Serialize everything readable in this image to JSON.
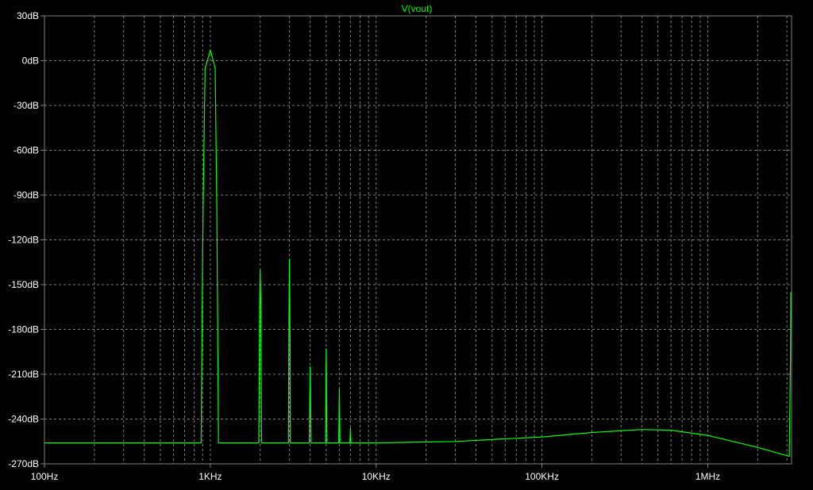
{
  "colors": {
    "background": "#000000",
    "frame": "#808080",
    "grid": "#808080",
    "trace": "#00ff00",
    "axis_text": "#ffffff",
    "title_text": "#00ff00"
  },
  "chart_data": {
    "type": "line",
    "title": "V(vout)",
    "xlabel": "",
    "ylabel": "",
    "x_scale": "log",
    "xlim": [
      100,
      3200000
    ],
    "ylim": [
      -270,
      30
    ],
    "grid": true,
    "x_tick_labels": [
      {
        "value": 100,
        "label": "100Hz"
      },
      {
        "value": 1000,
        "label": "1KHz"
      },
      {
        "value": 10000,
        "label": "10KHz"
      },
      {
        "value": 100000,
        "label": "100KHz"
      },
      {
        "value": 1000000,
        "label": "1MHz"
      }
    ],
    "y_tick_labels": [
      {
        "value": 30,
        "label": "30dB"
      },
      {
        "value": 0,
        "label": "0dB"
      },
      {
        "value": -30,
        "label": "-30dB"
      },
      {
        "value": -60,
        "label": "-60dB"
      },
      {
        "value": -90,
        "label": "-90dB"
      },
      {
        "value": -120,
        "label": "-120dB"
      },
      {
        "value": -150,
        "label": "-150dB"
      },
      {
        "value": -180,
        "label": "-180dB"
      },
      {
        "value": -210,
        "label": "-210dB"
      },
      {
        "value": -240,
        "label": "-240dB"
      },
      {
        "value": -270,
        "label": "-270dB"
      }
    ],
    "series": [
      {
        "name": "V(vout)",
        "points": [
          [
            100,
            -256
          ],
          [
            880,
            -256
          ],
          [
            890,
            -190
          ],
          [
            905,
            -100
          ],
          [
            930,
            -5
          ],
          [
            1000,
            7
          ],
          [
            1070,
            -5
          ],
          [
            1095,
            -100
          ],
          [
            1110,
            -190
          ],
          [
            1120,
            -256
          ],
          [
            1960,
            -256
          ],
          [
            1985,
            -160
          ],
          [
            2000,
            -140
          ],
          [
            2015,
            -160
          ],
          [
            2040,
            -256
          ],
          [
            2960,
            -256
          ],
          [
            2975,
            -185
          ],
          [
            2990,
            -155
          ],
          [
            3000,
            -133
          ],
          [
            3010,
            -155
          ],
          [
            3025,
            -185
          ],
          [
            3040,
            -256
          ],
          [
            3950,
            -256
          ],
          [
            3980,
            -225
          ],
          [
            4000,
            -205
          ],
          [
            4020,
            -225
          ],
          [
            4050,
            -256
          ],
          [
            4950,
            -256
          ],
          [
            4980,
            -215
          ],
          [
            5000,
            -193
          ],
          [
            5020,
            -215
          ],
          [
            5050,
            -256
          ],
          [
            5950,
            -256
          ],
          [
            5980,
            -235
          ],
          [
            6000,
            -220
          ],
          [
            6020,
            -235
          ],
          [
            6050,
            -256
          ],
          [
            6950,
            -256
          ],
          [
            6980,
            -250
          ],
          [
            7000,
            -246
          ],
          [
            7020,
            -250
          ],
          [
            7050,
            -256
          ],
          [
            10000,
            -256
          ],
          [
            30000,
            -255
          ],
          [
            100000,
            -252
          ],
          [
            200000,
            -249
          ],
          [
            400000,
            -247
          ],
          [
            600000,
            -247.5
          ],
          [
            1000000,
            -251
          ],
          [
            2000000,
            -259
          ],
          [
            3100000,
            -265
          ],
          [
            3150000,
            -200
          ],
          [
            3170000,
            -155
          ]
        ]
      }
    ]
  }
}
